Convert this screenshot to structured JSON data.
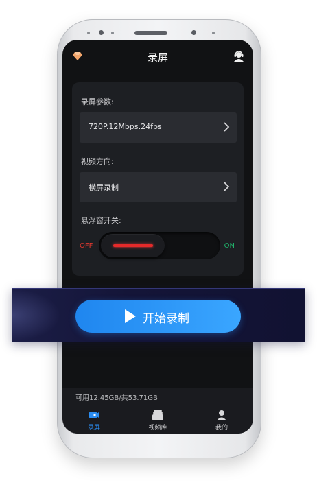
{
  "header": {
    "title": "录屏"
  },
  "settings": {
    "params_label": "录屏参数:",
    "params_value": "720P.12Mbps.24fps",
    "orientation_label": "视频方向:",
    "orientation_value": "横屏录制",
    "float_label": "悬浮窗开关:",
    "toggle_off": "OFF",
    "toggle_on": "ON",
    "float_enabled": false
  },
  "start": {
    "label": "开始录制"
  },
  "storage": {
    "text": "可用12.45GB/共53.71GB"
  },
  "tabs": [
    {
      "label": "录屏",
      "icon": "camera-icon",
      "active": true
    },
    {
      "label": "视频库",
      "icon": "video-library-icon",
      "active": false
    },
    {
      "label": "我的",
      "icon": "profile-icon",
      "active": false
    }
  ],
  "colors": {
    "accent": "#2b8cf0",
    "off": "#e0382f",
    "on": "#20b36b",
    "background": "#111214"
  }
}
